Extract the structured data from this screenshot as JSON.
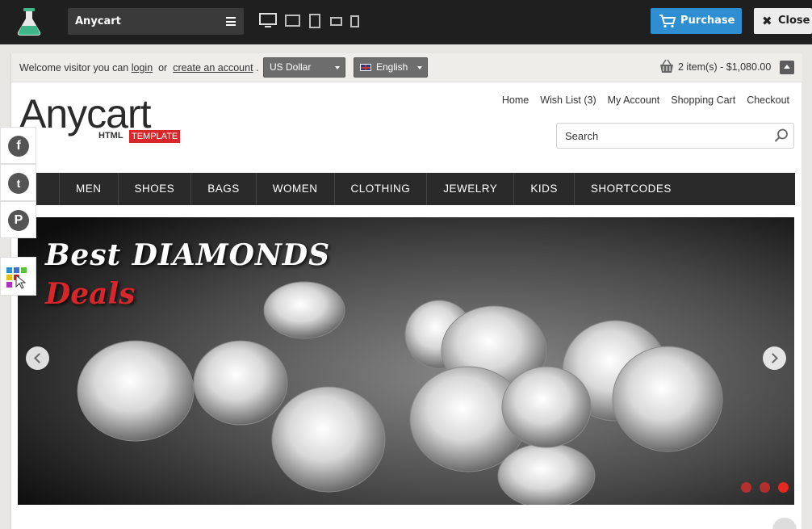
{
  "toolbar": {
    "theme_name": "Anycart",
    "purchase_label": "Purchase",
    "close_label": "Close",
    "devices": [
      "desktop",
      "tablet-landscape",
      "tablet-portrait",
      "phone-landscape",
      "phone-portrait"
    ]
  },
  "welcome": {
    "prefix": "Welcome visitor you can",
    "login": "login",
    "or": "or",
    "create_account": "create an account",
    "dot": ".",
    "currency": "US Dollar",
    "language": "English",
    "cart_summary": "2 item(s) - $1,080.00"
  },
  "logo": {
    "name": "Anycart",
    "sub": "HTML",
    "badge": "TEMPLATE"
  },
  "toplinks": [
    "Home",
    "Wish List (3)",
    "My Account",
    "Shopping Cart",
    "Checkout"
  ],
  "search": {
    "placeholder": "Search"
  },
  "nav": [
    "MEN",
    "SHOES",
    "BAGS",
    "WOMEN",
    "CLOTHING",
    "JEWELRY",
    "KIDS",
    "SHORTCODES"
  ],
  "slider": {
    "title_line1": "Best DIAMONDS",
    "title_line2": "Deals",
    "slide_count": 3,
    "active_slide": 3
  },
  "social": {
    "facebook": "f",
    "twitter": "t",
    "pinterest": "P"
  },
  "colors": {
    "accent": "#2d8fd1",
    "brand_red": "#d8262b",
    "nav_bg": "#2a2a2a"
  }
}
